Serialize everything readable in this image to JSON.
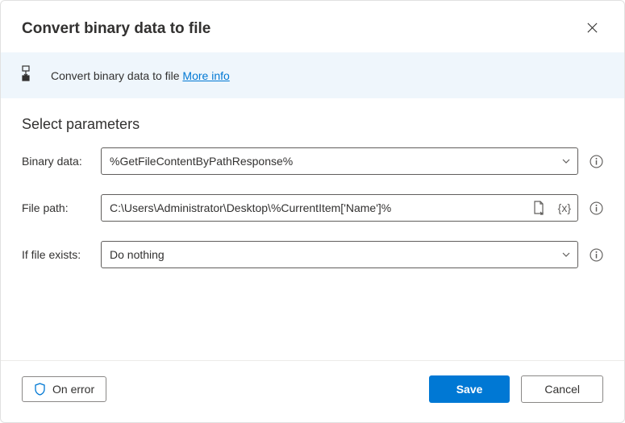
{
  "header": {
    "title": "Convert binary data to file"
  },
  "banner": {
    "text": "Convert binary data to file",
    "more_info": "More info"
  },
  "section": {
    "title": "Select parameters"
  },
  "fields": {
    "binary_data": {
      "label": "Binary data:",
      "value": "%GetFileContentByPathResponse%"
    },
    "file_path": {
      "label": "File path:",
      "value": "C:\\Users\\Administrator\\Desktop\\%CurrentItem['Name']%"
    },
    "if_file_exists": {
      "label": "If file exists:",
      "value": "Do nothing"
    }
  },
  "footer": {
    "on_error": "On error",
    "save": "Save",
    "cancel": "Cancel"
  }
}
